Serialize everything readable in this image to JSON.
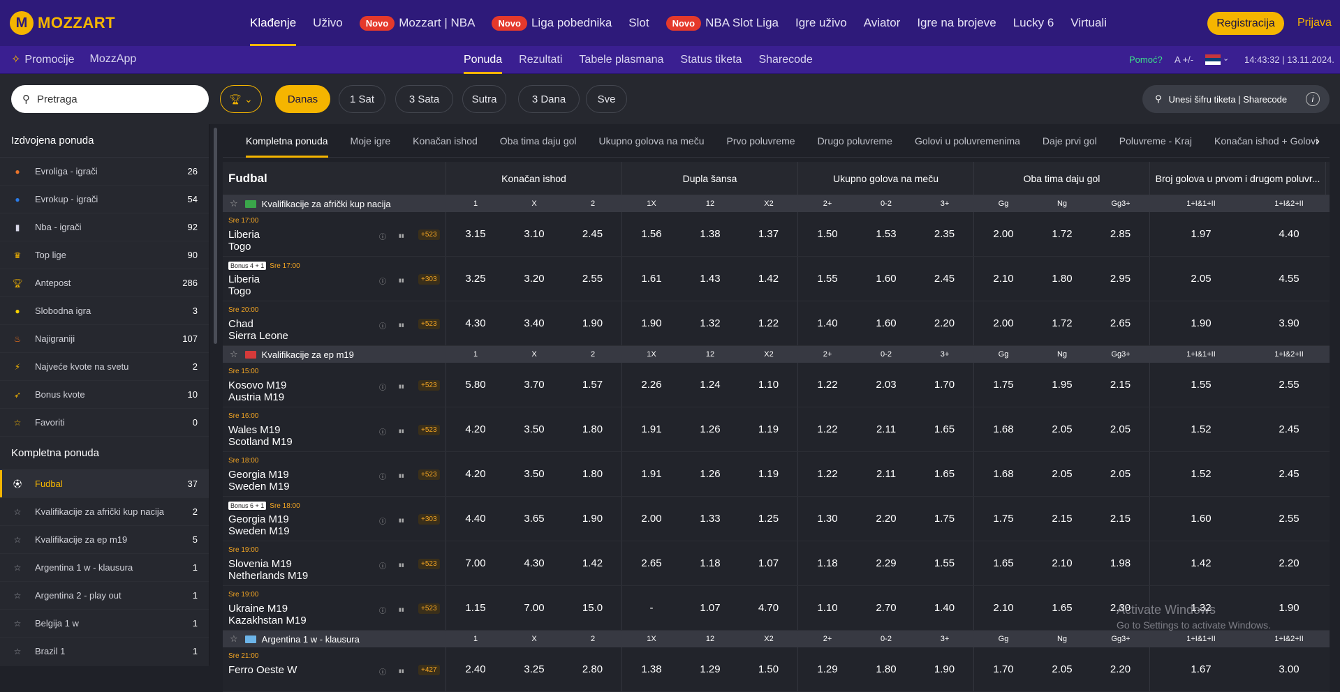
{
  "brand": {
    "logo_letter": "M",
    "name": "MOZZART"
  },
  "topnav": [
    {
      "label": "Klađenje",
      "active": true,
      "novo": false
    },
    {
      "label": "Uživo",
      "active": false,
      "novo": false
    },
    {
      "label": "Mozzart | NBA",
      "active": false,
      "novo": true
    },
    {
      "label": "Liga pobednika",
      "active": false,
      "novo": true
    },
    {
      "label": "Slot",
      "active": false,
      "novo": false
    },
    {
      "label": "NBA Slot Liga",
      "active": false,
      "novo": true
    },
    {
      "label": "Igre uživo",
      "active": false,
      "novo": false
    },
    {
      "label": "Aviator",
      "active": false,
      "novo": false
    },
    {
      "label": "Igre na brojeve",
      "active": false,
      "novo": false
    },
    {
      "label": "Lucky 6",
      "active": false,
      "novo": false
    },
    {
      "label": "Virtuali",
      "active": false,
      "novo": false
    }
  ],
  "novo_label": "Novo",
  "register_label": "Registracija",
  "login_label": "Prijava",
  "promo": {
    "promocije": "Promocije",
    "mozzapp": "MozzApp"
  },
  "subnav": [
    {
      "label": "Ponuda",
      "active": true
    },
    {
      "label": "Rezultati",
      "active": false
    },
    {
      "label": "Tabele plasmana",
      "active": false
    },
    {
      "label": "Status tiketa",
      "active": false
    },
    {
      "label": "Sharecode",
      "active": false
    }
  ],
  "help_label": "Pomoć?",
  "font_size_label": "A +/-",
  "datetime": "14:43:32 | 13.11.2024.",
  "search": {
    "placeholder": "Pretraga"
  },
  "time_filters": [
    {
      "label": "Danas",
      "active": true
    },
    {
      "label": "1 Sat",
      "active": false
    },
    {
      "label": "3 Sata",
      "active": false
    },
    {
      "label": "Sutra",
      "active": false
    },
    {
      "label": "3 Dana",
      "active": false
    },
    {
      "label": "Sve",
      "active": false
    }
  ],
  "sharecode_placeholder": "Unesi šifru tiketa | Sharecode",
  "sidebar": {
    "featured_title": "Izdvojena ponuda",
    "featured": [
      {
        "label": "Evroliga - igrači",
        "count": "26",
        "icon": "basketball-icon",
        "color": "#e8732a"
      },
      {
        "label": "Evrokup - igrači",
        "count": "54",
        "icon": "basketball-icon",
        "color": "#2a7be8"
      },
      {
        "label": "Nba - igrači",
        "count": "92",
        "icon": "nba-icon",
        "color": "#d8d8e8"
      },
      {
        "label": "Top lige",
        "count": "90",
        "icon": "crown-icon",
        "color": "#f5b500"
      },
      {
        "label": "Antepost",
        "count": "286",
        "icon": "trophy-icon",
        "color": "#f5b500"
      },
      {
        "label": "Slobodna igra",
        "count": "3",
        "icon": "bulb-icon",
        "color": "#f5d000"
      },
      {
        "label": "Najigraniji",
        "count": "107",
        "icon": "fire-icon",
        "color": "#f5731a"
      },
      {
        "label": "Najveće kvote na svetu",
        "count": "2",
        "icon": "bolt-icon",
        "color": "#f5b500"
      },
      {
        "label": "Bonus kvote",
        "count": "10",
        "icon": "rocket-icon",
        "color": "#f5b500"
      },
      {
        "label": "Favoriti",
        "count": "0",
        "icon": "star-icon",
        "color": "#f5b500"
      }
    ],
    "complete_title": "Kompletna ponuda",
    "complete": [
      {
        "label": "Fudbal",
        "count": "37",
        "icon": "football-icon",
        "active": true
      },
      {
        "label": "Kvalifikacije za afrički kup nacija",
        "count": "2",
        "icon": "star-outline-icon",
        "active": false
      },
      {
        "label": "Kvalifikacije za ep m19",
        "count": "5",
        "icon": "star-outline-icon",
        "active": false
      },
      {
        "label": "Argentina 1 w - klausura",
        "count": "1",
        "icon": "star-outline-icon",
        "active": false
      },
      {
        "label": "Argentina 2 - play out",
        "count": "1",
        "icon": "star-outline-icon",
        "active": false
      },
      {
        "label": "Belgija 1 w",
        "count": "1",
        "icon": "star-outline-icon",
        "active": false
      },
      {
        "label": "Brazil 1",
        "count": "1",
        "icon": "star-outline-icon",
        "active": false
      }
    ]
  },
  "markets": [
    "Kompletna ponuda",
    "Moje igre",
    "Konačan ishod",
    "Oba tima daju gol",
    "Ukupno golova na meču",
    "Prvo poluvreme",
    "Drugo poluvreme",
    "Golovi u poluvremenima",
    "Daje prvi gol",
    "Poluvreme - Kraj",
    "Konačan ishod + Golovi"
  ],
  "table": {
    "sport": "Fudbal",
    "groups": [
      "Konačan ishod",
      "Dupla šansa",
      "Ukupno golova na meču",
      "Oba tima daju gol",
      "Broj golova u prvom i drugom poluvr..."
    ],
    "columns": [
      "1",
      "X",
      "2",
      "1X",
      "12",
      "X2",
      "2+",
      "0-2",
      "3+",
      "Gg",
      "Ng",
      "Gg3+",
      "1+I&1+II",
      "1+I&2+II"
    ],
    "leagues": [
      {
        "name": "Kvalifikacije za afrički kup nacija",
        "flag_color": "#3aa64a",
        "matches": [
          {
            "time": "Sre 17:00",
            "bonus": "",
            "home": "Liberia",
            "away": "Togo",
            "more": "+523",
            "odds": [
              "3.15",
              "3.10",
              "2.45",
              "1.56",
              "1.38",
              "1.37",
              "1.50",
              "1.53",
              "2.35",
              "2.00",
              "1.72",
              "2.85",
              "1.97",
              "4.40"
            ]
          },
          {
            "time": "Sre 17:00",
            "bonus": "Bonus 4 + 1",
            "home": "Liberia",
            "away": "Togo",
            "more": "+303",
            "odds": [
              "3.25",
              "3.20",
              "2.55",
              "1.61",
              "1.43",
              "1.42",
              "1.55",
              "1.60",
              "2.45",
              "2.10",
              "1.80",
              "2.95",
              "2.05",
              "4.55"
            ]
          },
          {
            "time": "Sre 20:00",
            "bonus": "",
            "home": "Chad",
            "away": "Sierra Leone",
            "more": "+523",
            "odds": [
              "4.30",
              "3.40",
              "1.90",
              "1.90",
              "1.32",
              "1.22",
              "1.40",
              "1.60",
              "2.20",
              "2.00",
              "1.72",
              "2.65",
              "1.90",
              "3.90"
            ]
          }
        ]
      },
      {
        "name": "Kvalifikacije za ep m19",
        "flag_color": "#d63a3a",
        "matches": [
          {
            "time": "Sre 15:00",
            "bonus": "",
            "home": "Kosovo M19",
            "away": "Austria M19",
            "more": "+523",
            "odds": [
              "5.80",
              "3.70",
              "1.57",
              "2.26",
              "1.24",
              "1.10",
              "1.22",
              "2.03",
              "1.70",
              "1.75",
              "1.95",
              "2.15",
              "1.55",
              "2.55"
            ]
          },
          {
            "time": "Sre 16:00",
            "bonus": "",
            "home": "Wales M19",
            "away": "Scotland M19",
            "more": "+523",
            "odds": [
              "4.20",
              "3.50",
              "1.80",
              "1.91",
              "1.26",
              "1.19",
              "1.22",
              "2.11",
              "1.65",
              "1.68",
              "2.05",
              "2.05",
              "1.52",
              "2.45"
            ]
          },
          {
            "time": "Sre 18:00",
            "bonus": "",
            "home": "Georgia M19",
            "away": "Sweden M19",
            "more": "+523",
            "odds": [
              "4.20",
              "3.50",
              "1.80",
              "1.91",
              "1.26",
              "1.19",
              "1.22",
              "2.11",
              "1.65",
              "1.68",
              "2.05",
              "2.05",
              "1.52",
              "2.45"
            ]
          },
          {
            "time": "Sre 18:00",
            "bonus": "Bonus 6 + 1",
            "home": "Georgia M19",
            "away": "Sweden M19",
            "more": "+303",
            "odds": [
              "4.40",
              "3.65",
              "1.90",
              "2.00",
              "1.33",
              "1.25",
              "1.30",
              "2.20",
              "1.75",
              "1.75",
              "2.15",
              "2.15",
              "1.60",
              "2.55"
            ]
          },
          {
            "time": "Sre 19:00",
            "bonus": "",
            "home": "Slovenia M19",
            "away": "Netherlands M19",
            "more": "+523",
            "odds": [
              "7.00",
              "4.30",
              "1.42",
              "2.65",
              "1.18",
              "1.07",
              "1.18",
              "2.29",
              "1.55",
              "1.65",
              "2.10",
              "1.98",
              "1.42",
              "2.20"
            ]
          },
          {
            "time": "Sre 19:00",
            "bonus": "",
            "home": "Ukraine M19",
            "away": "Kazakhstan M19",
            "more": "+523",
            "odds": [
              "1.15",
              "7.00",
              "15.0",
              "-",
              "1.07",
              "4.70",
              "1.10",
              "2.70",
              "1.40",
              "2.10",
              "1.65",
              "2.30",
              "1.32",
              "1.90"
            ]
          }
        ]
      },
      {
        "name": "Argentina 1 w - klausura",
        "flag_color": "#6cb4e8",
        "matches": [
          {
            "time": "Sre 21:00",
            "bonus": "",
            "home": "Ferro Oeste W",
            "away": "",
            "more": "+427",
            "odds": [
              "2.40",
              "3.25",
              "2.80",
              "1.38",
              "1.29",
              "1.50",
              "1.29",
              "1.80",
              "1.90",
              "1.70",
              "2.05",
              "2.20",
              "1.67",
              "3.00"
            ]
          }
        ]
      }
    ]
  },
  "watermark": {
    "title": "Activate Windows",
    "subtitle": "Go to Settings to activate Windows."
  }
}
